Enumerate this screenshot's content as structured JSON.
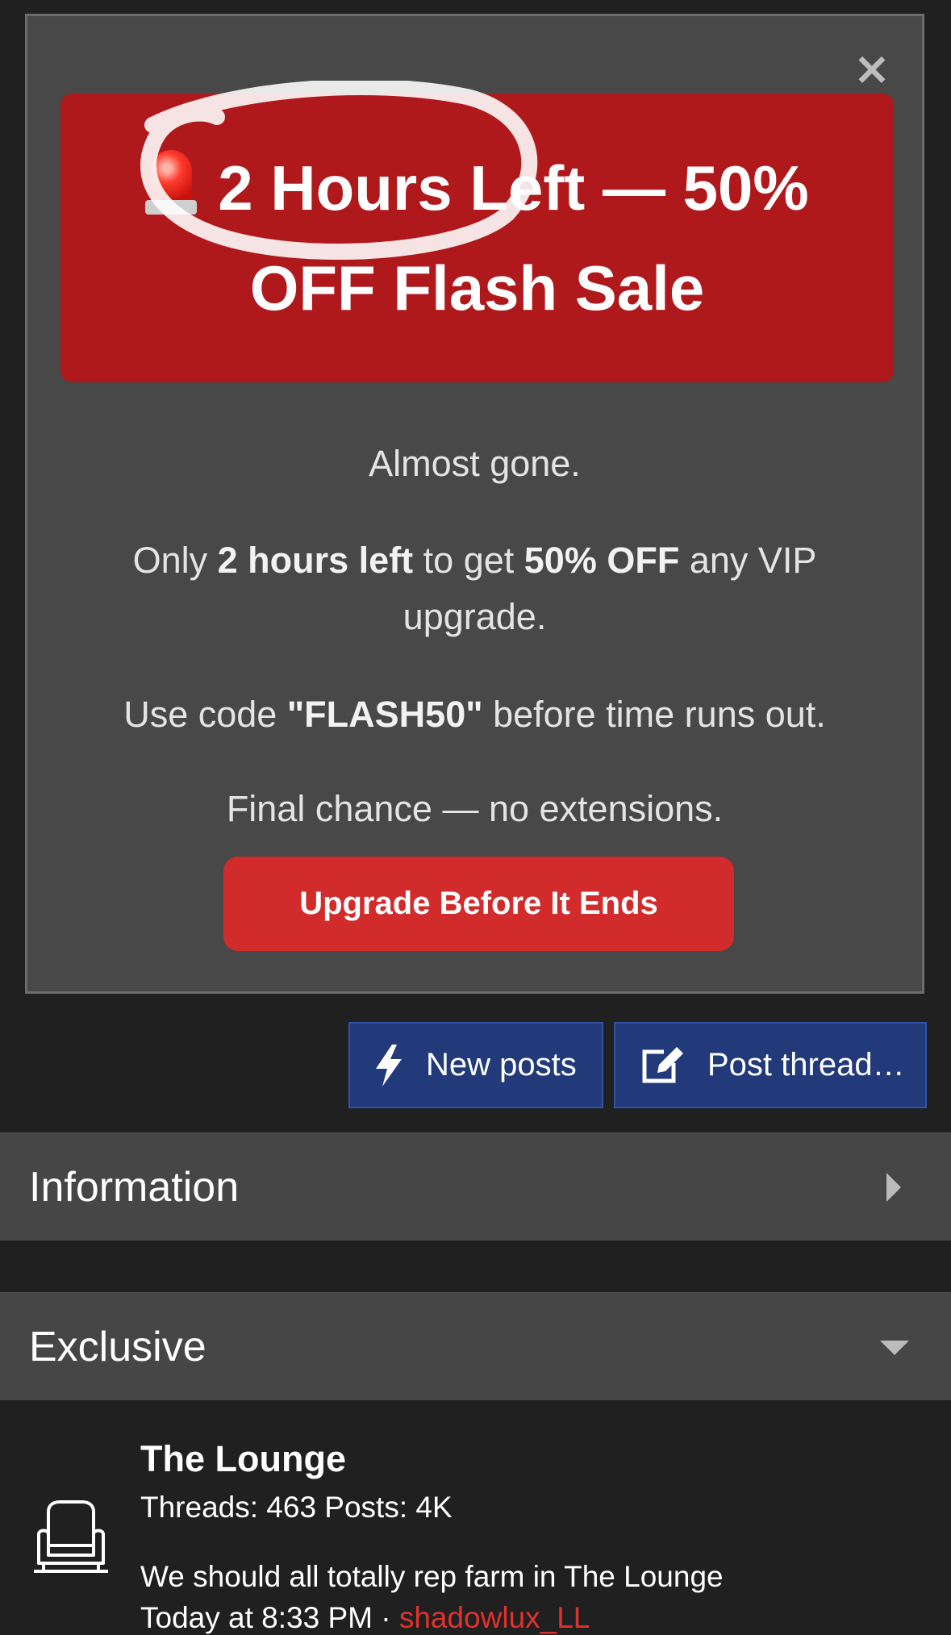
{
  "notice": {
    "banner_title": "2 Hours Left — 50% OFF Flash Sale",
    "line1": "Almost gone.",
    "line2_pre": "Only ",
    "line2_b1": "2 hours left",
    "line2_mid": " to get ",
    "line2_b2": "50% OFF",
    "line2_post": " any VIP upgrade.",
    "line3_pre": "Use code ",
    "line3_code": "\"FLASH50\"",
    "line3_post": " before time runs out.",
    "line4": "Final chance — no extensions.",
    "cta_label": "Upgrade Before It Ends",
    "close_glyph": "×"
  },
  "actions": {
    "new_posts": "New posts",
    "post_thread": "Post thread…"
  },
  "sections": [
    {
      "title": "Information",
      "icon": "caret-right-icon"
    },
    {
      "title": "Exclusive",
      "icon": "caret-down-icon"
    }
  ],
  "forum": {
    "title": "The Lounge",
    "stats": "Threads: 463 Posts: 4K",
    "latest": "We should all totally rep farm in The Lounge",
    "time": "Today at 8:33 PM · ",
    "user": "shadowlux_LL",
    "icon": "armchair-icon"
  },
  "colors": {
    "banner_red": "#b0191c",
    "cta_red": "#d12b2b",
    "button_blue": "#22397a",
    "username_red": "#e0322d"
  }
}
